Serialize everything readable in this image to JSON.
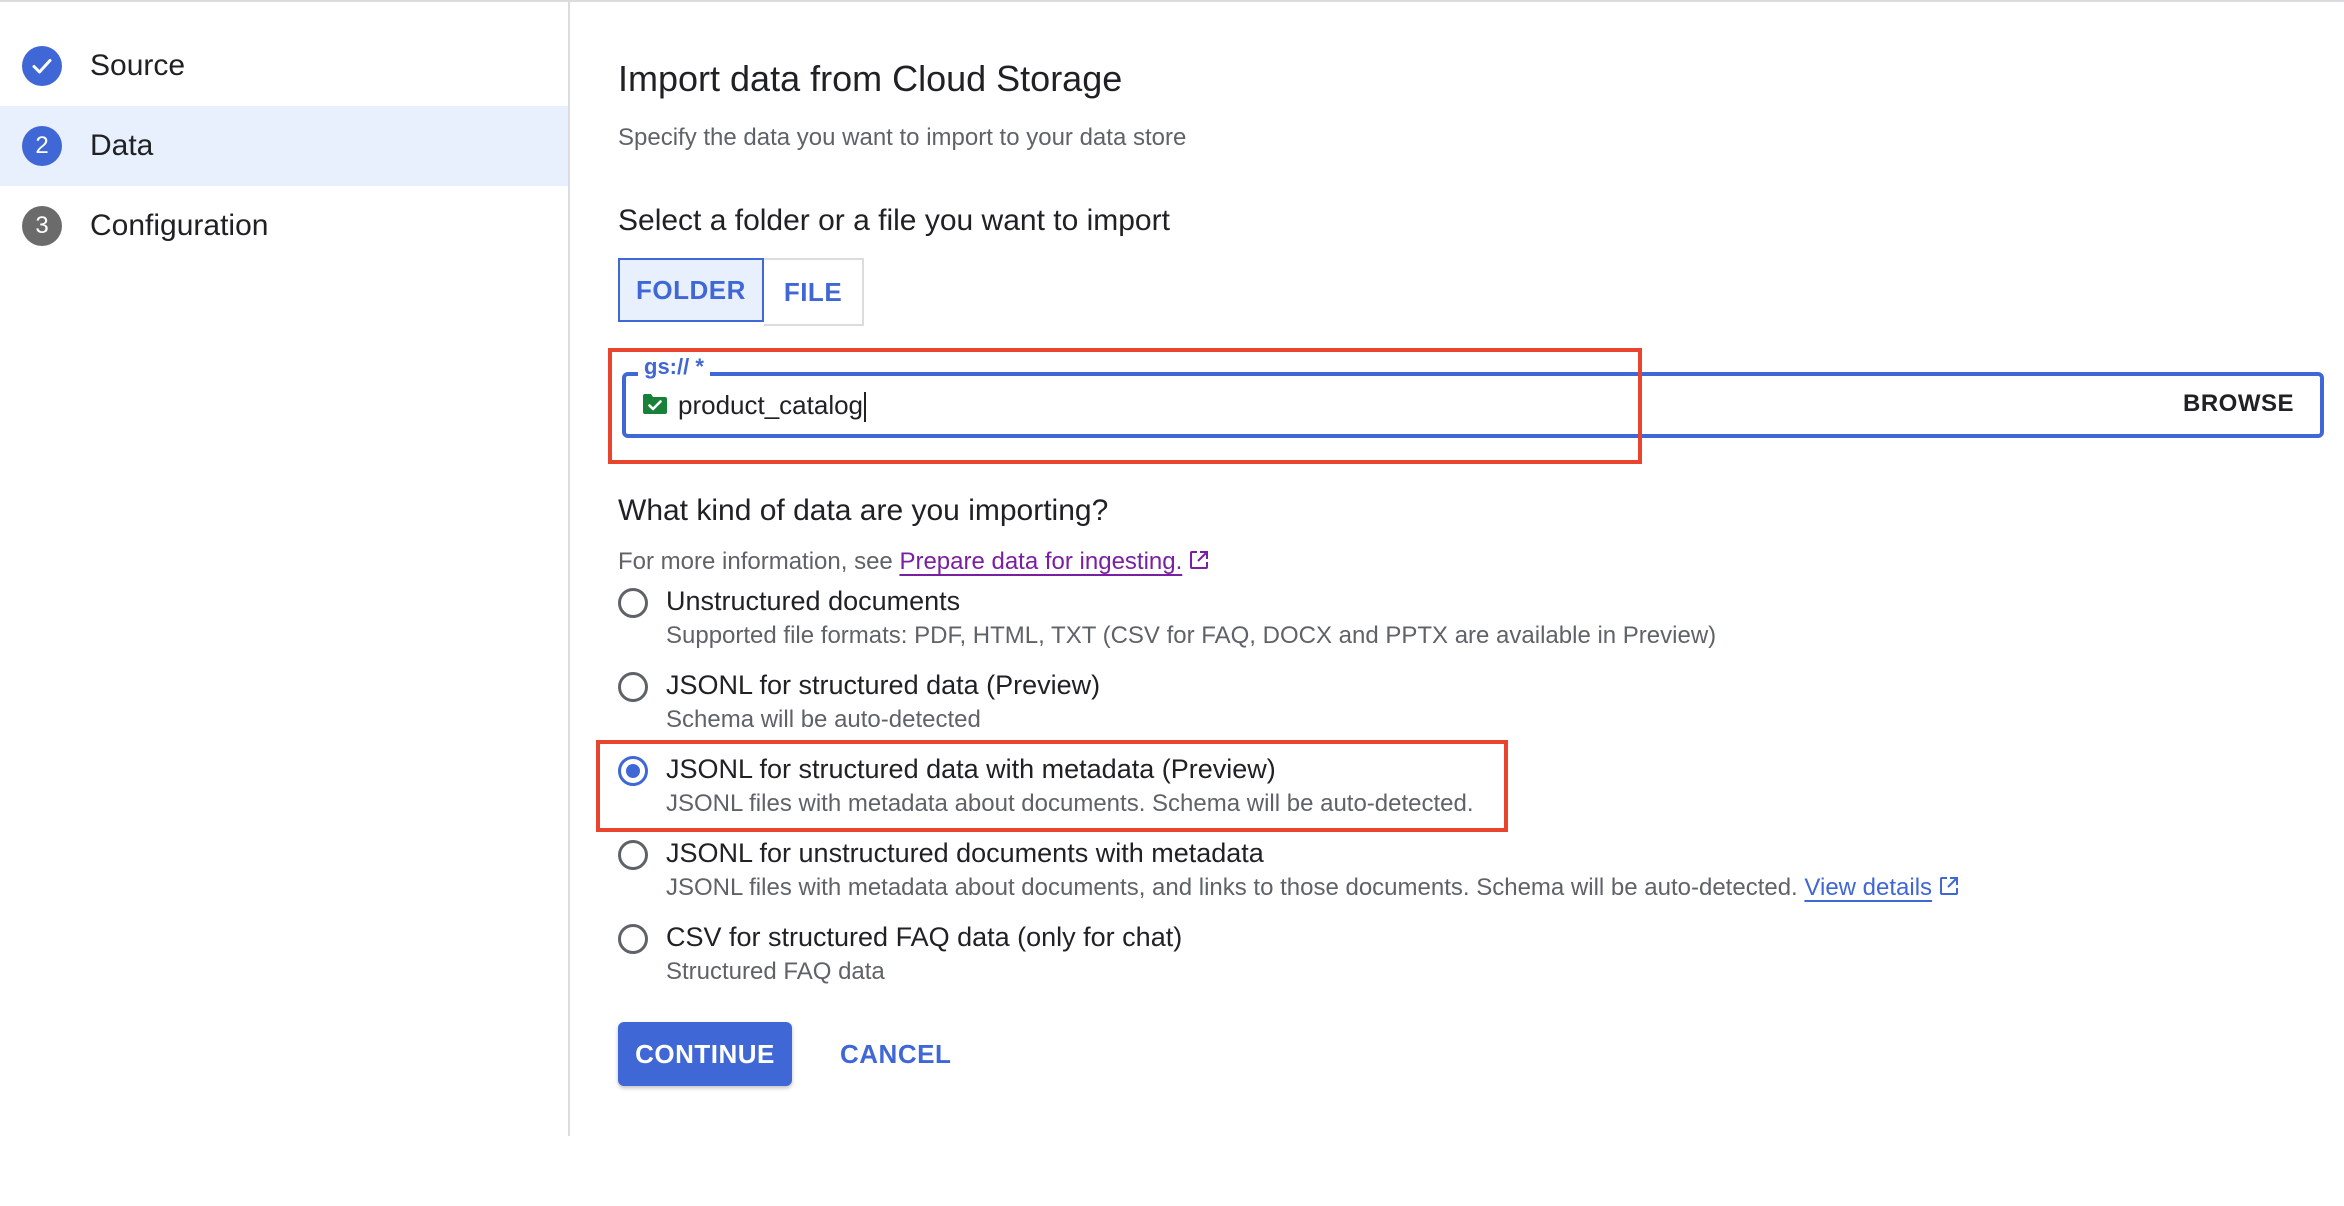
{
  "stepper": {
    "steps": [
      {
        "label": "Source",
        "state": "done"
      },
      {
        "label": "Data",
        "number": "2",
        "state": "active"
      },
      {
        "label": "Configuration",
        "number": "3",
        "state": "pending"
      }
    ]
  },
  "main": {
    "title": "Import data from Cloud Storage",
    "subtitle": "Specify the data you want to import to your data store",
    "select_heading": "Select a folder or a file you want to import",
    "toggle": {
      "folder": "FOLDER",
      "file": "FILE",
      "selected": "FOLDER"
    },
    "path_field": {
      "label": "gs:// *",
      "value": "product_catalog",
      "browse": "BROWSE"
    },
    "kind_heading": "What kind of data are you importing?",
    "info_prefix": "For more information, see ",
    "info_link": "Prepare data for ingesting.",
    "options": [
      {
        "title": "Unstructured documents",
        "desc": "Supported file formats: PDF, HTML, TXT (CSV for FAQ, DOCX and PPTX are available in Preview)",
        "checked": false
      },
      {
        "title": "JSONL for structured data (Preview)",
        "desc": "Schema will be auto-detected",
        "checked": false
      },
      {
        "title": "JSONL for structured data with metadata (Preview)",
        "desc": "JSONL files with metadata about documents. Schema will be auto-detected.",
        "checked": true
      },
      {
        "title": "JSONL for unstructured documents with metadata",
        "desc": "JSONL files with metadata about documents, and links to those documents. Schema will be auto-detected. ",
        "link": "View details",
        "checked": false
      },
      {
        "title": "CSV for structured FAQ data (only for chat)",
        "desc": "Structured FAQ data",
        "checked": false
      }
    ],
    "continue": "CONTINUE",
    "cancel": "CANCEL"
  },
  "colors": {
    "accent": "#3f67d5",
    "callout": "#e8442e",
    "active_step_bg": "#e8f0fe"
  }
}
